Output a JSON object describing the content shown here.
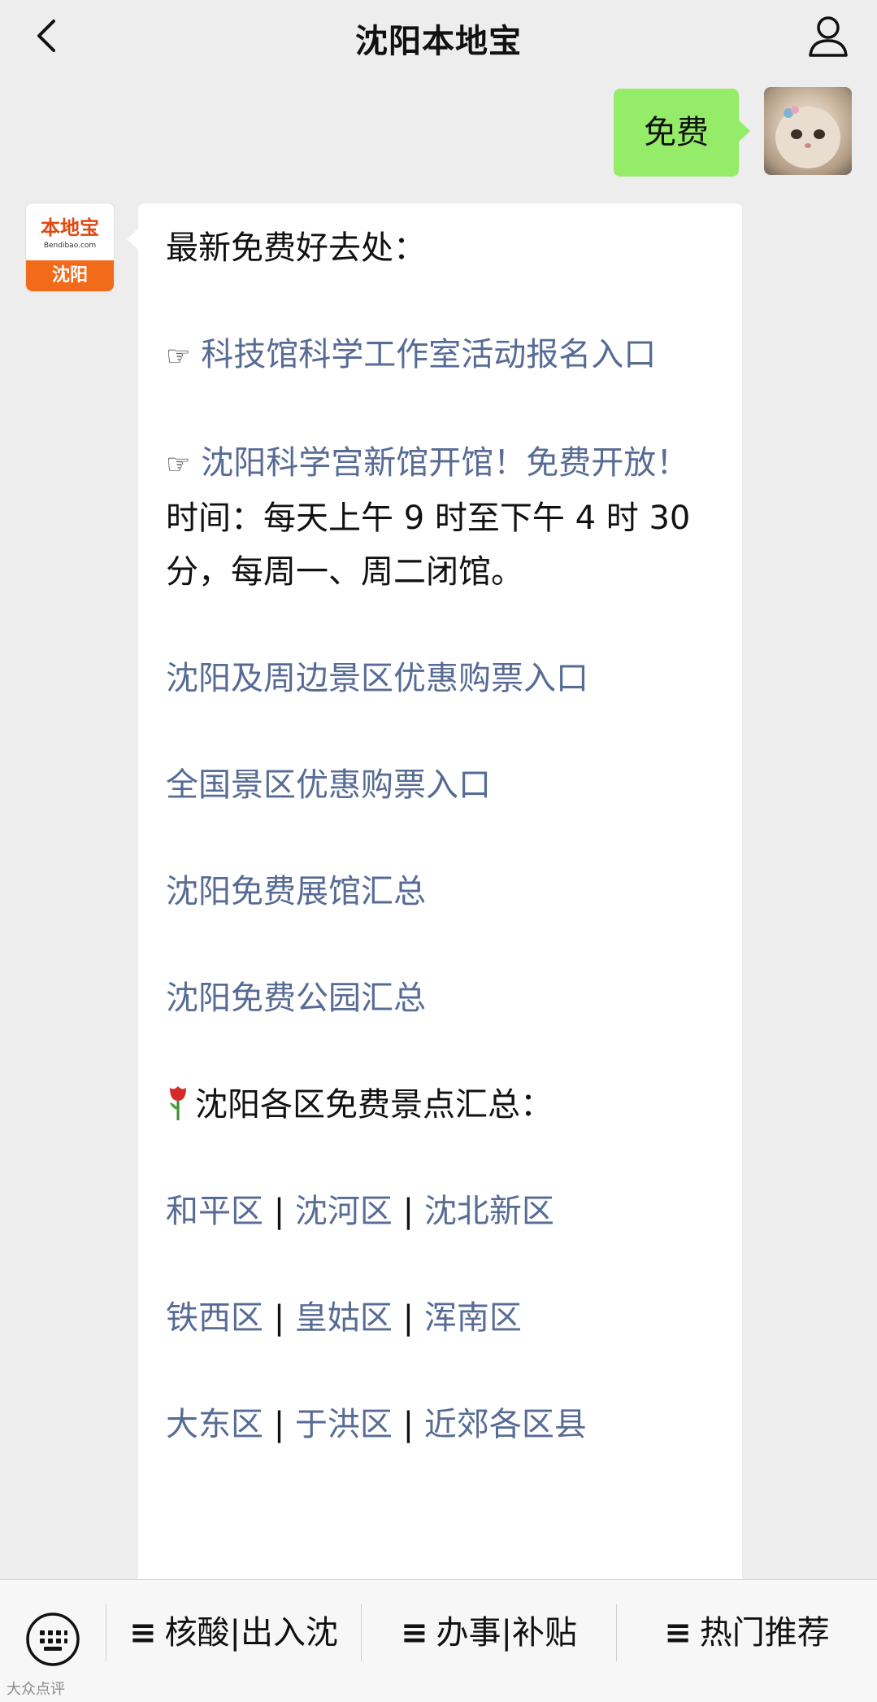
{
  "header": {
    "title": "沈阳本地宝"
  },
  "messages": {
    "outgoing": "免费",
    "bot_avatar": {
      "logo_text": "本地宝",
      "logo_sub": "Bendibao.com",
      "city": "沈阳"
    },
    "incoming": {
      "heading": "最新免费好去处：",
      "item1": "科技馆科学工作室活动报名入口",
      "item2": "沈阳科学宫新馆开馆！免费开放！",
      "hours": "时间：每天上午 9 时至下午 4 时 30 分，每周一、周二闭馆。",
      "link3": "沈阳及周边景区优惠购票入口",
      "link4": "全国景区优惠购票入口",
      "link5": "沈阳免费展馆汇总",
      "link6": "沈阳免费公园汇总",
      "section": "沈阳各区免费景点汇总：",
      "districts": {
        "heping": "和平区",
        "shenhe": "沈河区",
        "shenbei": "沈北新区",
        "tiexi": "铁西区",
        "huanggu": "皇姑区",
        "hunnan": "浑南区",
        "dadong": "大东区",
        "yuhong": "于洪区",
        "jinjiao": "近郊各区县"
      },
      "separator": "|"
    }
  },
  "bottom_bar": {
    "menu1": "核酸|出入沈",
    "menu2": "办事|补贴",
    "menu3": "热门推荐"
  },
  "watermark": "大众点评"
}
